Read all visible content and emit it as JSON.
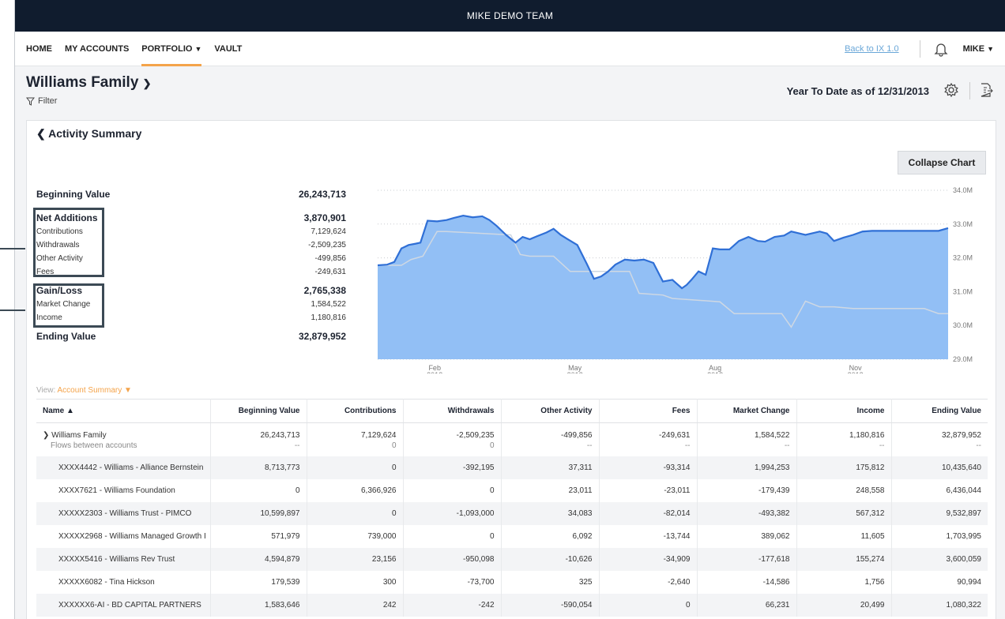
{
  "app": {
    "team": "MIKE DEMO TEAM"
  },
  "nav": {
    "items": [
      {
        "label": "HOME"
      },
      {
        "label": "MY ACCOUNTS"
      },
      {
        "label": "PORTFOLIO"
      },
      {
        "label": "VAULT"
      }
    ],
    "back_link": "Back to IX 1.0",
    "user": "MIKE"
  },
  "header": {
    "family": "Williams Family",
    "filter_label": "Filter",
    "period": "Year To Date as of 12/31/2013"
  },
  "card": {
    "title": "Activity Summary",
    "collapse_label": "Collapse Chart",
    "view_prefix": "View:",
    "view_value": "Account Summary"
  },
  "summary": {
    "beginning": {
      "label": "Beginning Value",
      "value": "26,243,713"
    },
    "net_additions": {
      "label": "Net Additions",
      "value": "3,870,901"
    },
    "contributions": {
      "label": "Contributions",
      "value": "7,129,624"
    },
    "withdrawals": {
      "label": "Withdrawals",
      "value": "-2,509,235"
    },
    "other": {
      "label": "Other Activity",
      "value": "-499,856"
    },
    "fees": {
      "label": "Fees",
      "value": "-249,631"
    },
    "gain_loss": {
      "label": "Gain/Loss",
      "value": "2,765,338"
    },
    "market_change": {
      "label": "Market Change",
      "value": "1,584,522"
    },
    "income": {
      "label": "Income",
      "value": "1,180,816"
    },
    "ending": {
      "label": "Ending Value",
      "value": "32,879,952"
    }
  },
  "chart_data": {
    "type": "area",
    "y_ticks": [
      "34.0M",
      "33.0M",
      "32.0M",
      "31.0M",
      "30.0M",
      "29.0M"
    ],
    "ylim": [
      29.0,
      34.0
    ],
    "x_ticks": [
      {
        "month": "Feb",
        "year": "2013",
        "pos": 1.2
      },
      {
        "month": "May",
        "year": "2013",
        "pos": 4.15
      },
      {
        "month": "Aug",
        "year": "2013",
        "pos": 7.1
      },
      {
        "month": "Nov",
        "year": "2013",
        "pos": 10.05
      }
    ],
    "grid": true,
    "colors": {
      "area": "#92bff5",
      "line": "#2f6fd6",
      "secondary": "#cfd8e3"
    },
    "series": [
      {
        "x": [
          0,
          0.2,
          0.35,
          0.5,
          0.65,
          0.8,
          0.9,
          1.05,
          1.25,
          1.45,
          1.6,
          1.8,
          2.0,
          2.2,
          2.35,
          2.5,
          2.7,
          2.9,
          3.05,
          3.2,
          3.35,
          3.55,
          3.7,
          3.85,
          4.0,
          4.2,
          4.4,
          4.55,
          4.7,
          4.85,
          5.0,
          5.2,
          5.4,
          5.6,
          5.8,
          6.0,
          6.2,
          6.4,
          6.5,
          6.6,
          6.75,
          6.9,
          7.05,
          7.2,
          7.4,
          7.6,
          7.8,
          8.0,
          8.15,
          8.35,
          8.55,
          8.7,
          9.0,
          9.3,
          9.45,
          9.6,
          9.8,
          10.0,
          10.2,
          10.4,
          10.6,
          10.8,
          11.0,
          11.2,
          11.4,
          11.6,
          11.8,
          12.0
        ],
        "y": [
          31.78,
          31.8,
          31.88,
          32.28,
          32.38,
          32.42,
          32.45,
          33.1,
          33.08,
          33.12,
          33.18,
          33.25,
          33.2,
          33.23,
          33.12,
          32.95,
          32.68,
          32.45,
          32.62,
          32.55,
          32.64,
          32.75,
          32.86,
          32.68,
          32.55,
          32.38,
          31.82,
          31.38,
          31.45,
          31.6,
          31.8,
          31.95,
          31.92,
          31.95,
          31.85,
          31.3,
          31.35,
          31.1,
          31.2,
          31.35,
          31.6,
          31.5,
          32.28,
          32.25,
          32.25,
          32.5,
          32.62,
          32.5,
          32.48,
          32.62,
          32.66,
          32.78,
          32.68,
          32.78,
          32.72,
          32.5,
          32.6,
          32.68,
          32.78,
          32.8,
          32.8,
          32.8,
          32.8,
          32.8,
          32.8,
          32.8,
          32.8,
          32.88
        ]
      },
      {
        "x": [
          0,
          0.5,
          0.7,
          0.95,
          1.25,
          1.45,
          2.8,
          3.0,
          3.2,
          3.7,
          4.05,
          5.3,
          5.5,
          6.0,
          6.2,
          7.2,
          7.5,
          8.5,
          8.7,
          9.0,
          9.3,
          9.6,
          10.0,
          11.5,
          11.8,
          12.0
        ],
        "y": [
          31.78,
          31.78,
          31.95,
          32.05,
          32.78,
          32.78,
          32.68,
          32.1,
          32.05,
          32.05,
          31.6,
          31.6,
          30.95,
          30.9,
          30.8,
          30.7,
          30.35,
          30.35,
          29.95,
          30.72,
          30.55,
          30.55,
          30.5,
          30.5,
          30.35,
          30.35
        ]
      }
    ]
  },
  "table": {
    "headers": [
      "Name",
      "Beginning Value",
      "Contributions",
      "Withdrawals",
      "Other Activity",
      "Fees",
      "Market Change",
      "Income",
      "Ending Value"
    ],
    "group": {
      "name": "Williams Family",
      "sub": "Flows between accounts",
      "values": [
        "26,243,713",
        "7,129,624",
        "-2,509,235",
        "-499,856",
        "-249,631",
        "1,584,522",
        "1,180,816",
        "32,879,952"
      ],
      "subs": [
        "--",
        "0",
        "0",
        "--",
        "--",
        "--",
        "--",
        "--"
      ]
    },
    "rows": [
      {
        "name": "XXXX4442 - Williams - Alliance Bernstein",
        "values": [
          "8,713,773",
          "0",
          "-392,195",
          "37,311",
          "-93,314",
          "1,994,253",
          "175,812",
          "10,435,640"
        ]
      },
      {
        "name": "XXXX7621 - Williams Foundation",
        "values": [
          "0",
          "6,366,926",
          "0",
          "23,011",
          "-23,011",
          "-179,439",
          "248,558",
          "6,436,044"
        ]
      },
      {
        "name": "XXXXX2303 - Williams Trust - PIMCO",
        "values": [
          "10,599,897",
          "0",
          "-1,093,000",
          "34,083",
          "-82,014",
          "-493,382",
          "567,312",
          "9,532,897"
        ]
      },
      {
        "name": "XXXXX2968 - Williams Managed Growth I",
        "values": [
          "571,979",
          "739,000",
          "0",
          "6,092",
          "-13,744",
          "389,062",
          "11,605",
          "1,703,995"
        ]
      },
      {
        "name": "XXXXX5416 - Williams Rev Trust",
        "values": [
          "4,594,879",
          "23,156",
          "-950,098",
          "-10,626",
          "-34,909",
          "-177,618",
          "155,274",
          "3,600,059"
        ]
      },
      {
        "name": "XXXXX6082 - Tina Hickson",
        "values": [
          "179,539",
          "300",
          "-73,700",
          "325",
          "-2,640",
          "-14,586",
          "1,756",
          "90,994"
        ]
      },
      {
        "name": "XXXXXX6-AI - BD CAPITAL PARTNERS",
        "values": [
          "1,583,646",
          "242",
          "-242",
          "-590,054",
          "0",
          "66,231",
          "20,499",
          "1,080,322"
        ]
      }
    ]
  }
}
